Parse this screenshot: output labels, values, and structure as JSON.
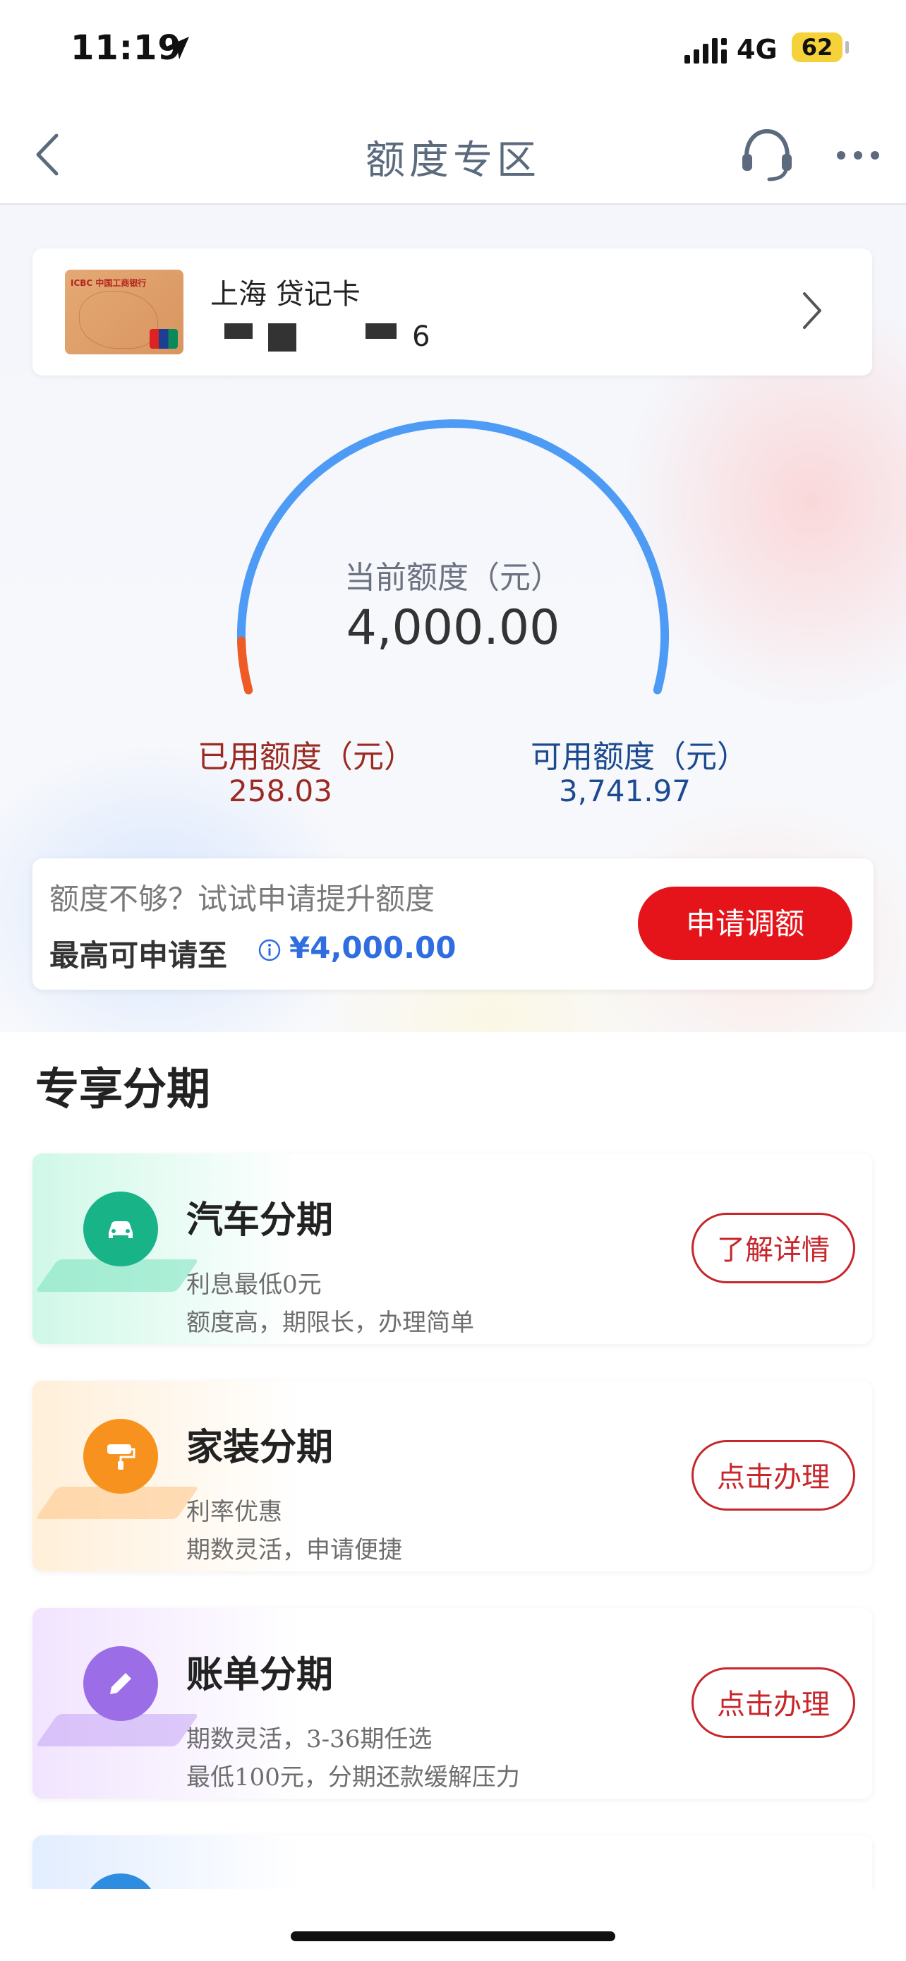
{
  "status_bar": {
    "time": "11:19",
    "network": "4G",
    "battery": "62"
  },
  "nav": {
    "title": "额度专区"
  },
  "card": {
    "name": "上海 贷记卡",
    "number_suffix": "6"
  },
  "gauge": {
    "current_label": "当前额度（元）",
    "current_value": "4,000.00",
    "used_label": "已用额度（元）",
    "used_value": "258.03",
    "available_label": "可用额度（元）",
    "available_value": "3,741.97",
    "used_fraction": 0.0645,
    "colors": {
      "track": "#4e9bf5",
      "used": "#f05a23"
    }
  },
  "increase": {
    "hint": "额度不够？试试申请提升额度",
    "max_label": "最高可申请至",
    "max_amount": "¥4,000.00",
    "button": "申请调额"
  },
  "section_title": "专享分期",
  "products": [
    {
      "title": "汽车分期",
      "line1": "利息最低0元",
      "line2": "额度高，期限长，办理简单",
      "button": "了解详情",
      "icon": "car-icon",
      "color": "#19b388"
    },
    {
      "title": "家装分期",
      "line1": "利率优惠",
      "line2": "期数灵活，申请便捷",
      "button": "点击办理",
      "icon": "paint-roller-icon",
      "color": "#f7921e"
    },
    {
      "title": "账单分期",
      "line1": "期数灵活，3-36期任选",
      "line2": "最低100元，分期还款缓解压力",
      "button": "点击办理",
      "icon": "pencil-icon",
      "color": "#9b6ee8"
    }
  ]
}
